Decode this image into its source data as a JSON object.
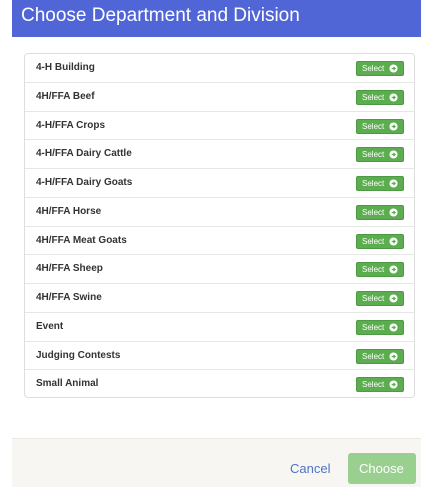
{
  "modal": {
    "title": "Choose Department and Division"
  },
  "items": [
    {
      "label": "4-H Building",
      "button": "Select"
    },
    {
      "label": "4H/FFA Beef",
      "button": "Select"
    },
    {
      "label": "4-H/FFA Crops",
      "button": "Select"
    },
    {
      "label": "4-H/FFA Dairy Cattle",
      "button": "Select"
    },
    {
      "label": "4-H/FFA Dairy Goats",
      "button": "Select"
    },
    {
      "label": "4H/FFA Horse",
      "button": "Select"
    },
    {
      "label": "4H/FFA Meat Goats",
      "button": "Select"
    },
    {
      "label": "4H/FFA Sheep",
      "button": "Select"
    },
    {
      "label": "4H/FFA Swine",
      "button": "Select"
    },
    {
      "label": "Event",
      "button": "Select"
    },
    {
      "label": "Judging Contests",
      "button": "Select"
    },
    {
      "label": "Small Animal",
      "button": "Select"
    }
  ],
  "footer": {
    "cancel_label": "Cancel",
    "choose_label": "Choose"
  },
  "icons": {
    "select_arrow": "arrow-right-circle-icon"
  },
  "colors": {
    "header": "#5166d6",
    "select_button": "#5cad4f",
    "choose_button": "#9ad08f",
    "cancel_link": "#4d74c5"
  }
}
